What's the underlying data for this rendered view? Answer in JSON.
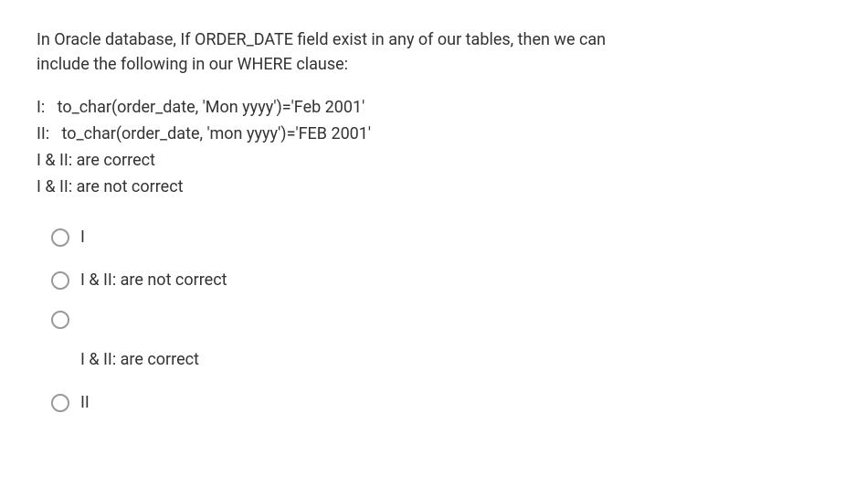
{
  "question": {
    "line1": "In Oracle database, If ORDER_DATE field exist in any of our tables, then we can",
    "line2": "include the following in our WHERE clause:"
  },
  "statements": {
    "s1": "I:   to_char(order_date, 'Mon yyyy')='Feb 2001'",
    "s2": "II:   to_char(order_date, 'mon yyyy')='FEB 2001'",
    "s3": "I & II: are correct",
    "s4": "I & II: are not correct"
  },
  "options": {
    "o1": "I",
    "o2": "I & II: are not correct",
    "o3": "",
    "o4": "I & II: are correct",
    "o5": "II"
  }
}
